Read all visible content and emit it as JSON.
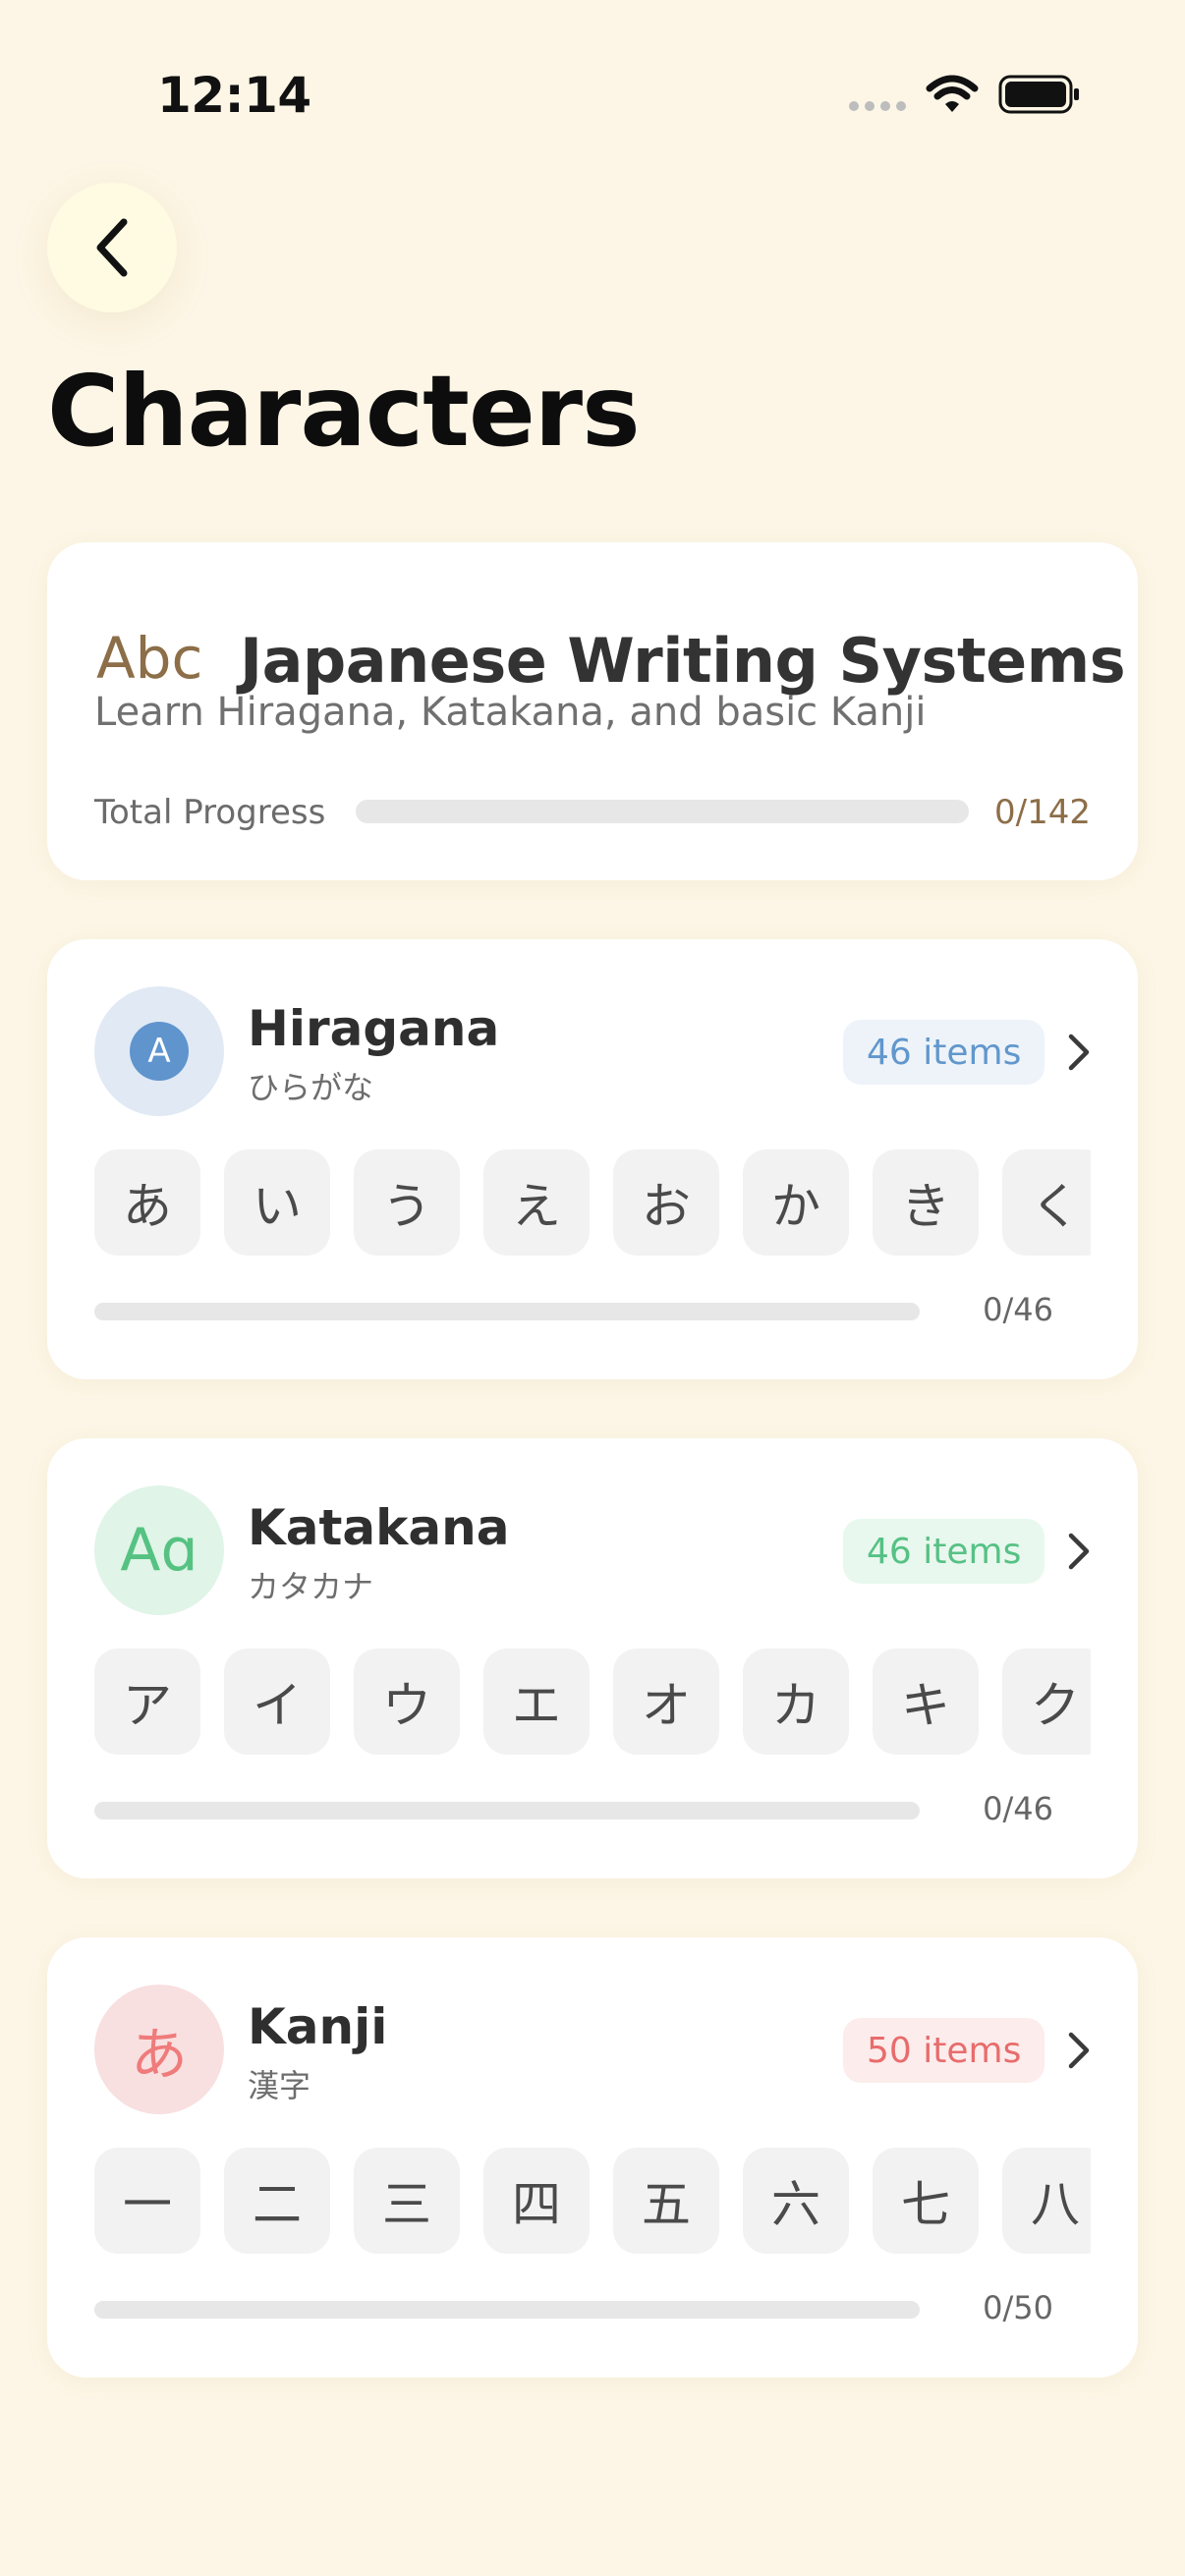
{
  "status_bar": {
    "time": "12:14"
  },
  "header": {
    "title": "Characters"
  },
  "overview": {
    "icon_text": "Abc",
    "title": "Japanese Writing Systems",
    "subtitle": "Learn Hiragana, Katakana, and basic Kanji",
    "progress_label": "Total Progress",
    "progress_text": "0/142",
    "progress_fraction": 0
  },
  "sections": [
    {
      "title": "Hiragana",
      "subtitle": "ひらがな",
      "avatar_text": "A",
      "badge": "46 items",
      "accent": "#5f94cd",
      "characters": [
        "あ",
        "い",
        "う",
        "え",
        "お",
        "か",
        "き",
        "く"
      ],
      "progress_text": "0/46",
      "progress_fraction": 0
    },
    {
      "title": "Katakana",
      "subtitle": "カタカナ",
      "avatar_text": "Aɑ",
      "badge": "46 items",
      "accent": "#55c282",
      "characters": [
        "ア",
        "イ",
        "ウ",
        "エ",
        "オ",
        "カ",
        "キ",
        "ク"
      ],
      "progress_text": "0/46",
      "progress_fraction": 0
    },
    {
      "title": "Kanji",
      "subtitle": "漢字",
      "avatar_text": "あ",
      "badge": "50 items",
      "accent": "#ef7b7b",
      "characters": [
        "一",
        "二",
        "三",
        "四",
        "五",
        "六",
        "七",
        "八"
      ],
      "progress_text": "0/50",
      "progress_fraction": 0
    }
  ],
  "icons": {
    "back": "chevron-left-icon",
    "section_arrow": "chevron-right-icon",
    "wifi": "wifi-icon",
    "battery": "battery-icon"
  },
  "colors": {
    "background": "#fdf6e6",
    "card": "#ffffff",
    "brown_accent": "#8c6e48",
    "track": "#e7e7e7"
  }
}
